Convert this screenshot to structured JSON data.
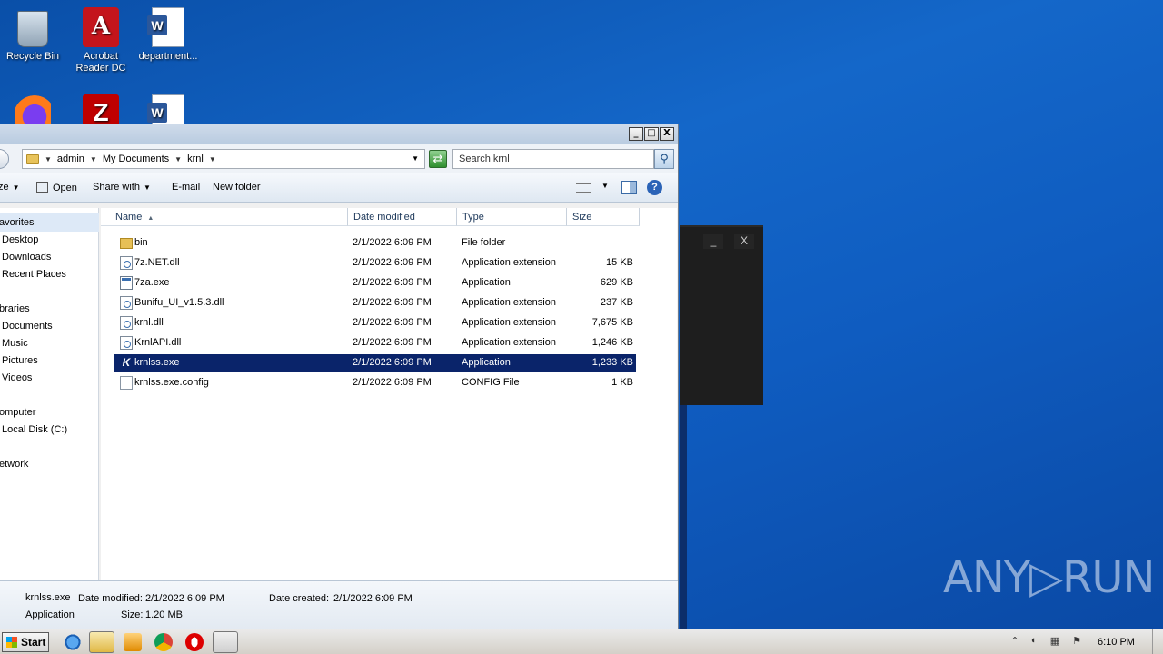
{
  "desktop": {
    "icons": [
      {
        "label": "Recycle Bin"
      },
      {
        "label": "Acrobat Reader DC"
      },
      {
        "label": "department..."
      }
    ]
  },
  "explorer": {
    "window_buttons": {
      "minimize": "_",
      "maximize": "□",
      "close": "X"
    },
    "breadcrumb": [
      "admin",
      "My Documents",
      "krnl"
    ],
    "search_placeholder": "Search krnl",
    "toolbar": {
      "organize_label": "ze",
      "open_label": "Open",
      "share_label": "Share with",
      "email_label": "E-mail",
      "new_folder_label": "New folder"
    },
    "nav": {
      "favorites": "avorites",
      "desktop": "Desktop",
      "downloads": "Downloads",
      "recent": "Recent Places",
      "libraries": "braries",
      "documents": "Documents",
      "music": "Music",
      "pictures": "Pictures",
      "videos": "Videos",
      "computer": "omputer",
      "localdisk": "Local Disk (C:)",
      "network": "etwork"
    },
    "columns": [
      "Name",
      "Date modified",
      "Type",
      "Size"
    ],
    "files": [
      {
        "name": "bin",
        "date": "2/1/2022 6:09 PM",
        "type": "File folder",
        "size": ""
      },
      {
        "name": "7z.NET.dll",
        "date": "2/1/2022 6:09 PM",
        "type": "Application extension",
        "size": "15 KB"
      },
      {
        "name": "7za.exe",
        "date": "2/1/2022 6:09 PM",
        "type": "Application",
        "size": "629 KB"
      },
      {
        "name": "Bunifu_UI_v1.5.3.dll",
        "date": "2/1/2022 6:09 PM",
        "type": "Application extension",
        "size": "237 KB"
      },
      {
        "name": "krnl.dll",
        "date": "2/1/2022 6:09 PM",
        "type": "Application extension",
        "size": "7,675 KB"
      },
      {
        "name": "KrnlAPI.dll",
        "date": "2/1/2022 6:09 PM",
        "type": "Application extension",
        "size": "1,246 KB"
      },
      {
        "name": "krnlss.exe",
        "date": "2/1/2022 6:09 PM",
        "type": "Application",
        "size": "1,233 KB"
      },
      {
        "name": "krnlss.exe.config",
        "date": "2/1/2022 6:09 PM",
        "type": "CONFIG File",
        "size": "1 KB"
      }
    ],
    "details": {
      "filename": "krnlss.exe",
      "date_modified_label": "Date modified:",
      "date_modified": "2/1/2022 6:09 PM",
      "date_created_label": "Date created:",
      "date_created": "2/1/2022 6:09 PM",
      "type": "Application",
      "size_label": "Size:",
      "size": "1.20 MB"
    }
  },
  "dark_window": {
    "minimize": "_",
    "close": "X"
  },
  "watermark": "ANY▷RUN",
  "taskbar": {
    "start_label": "Start",
    "clock": "6:10 PM"
  }
}
